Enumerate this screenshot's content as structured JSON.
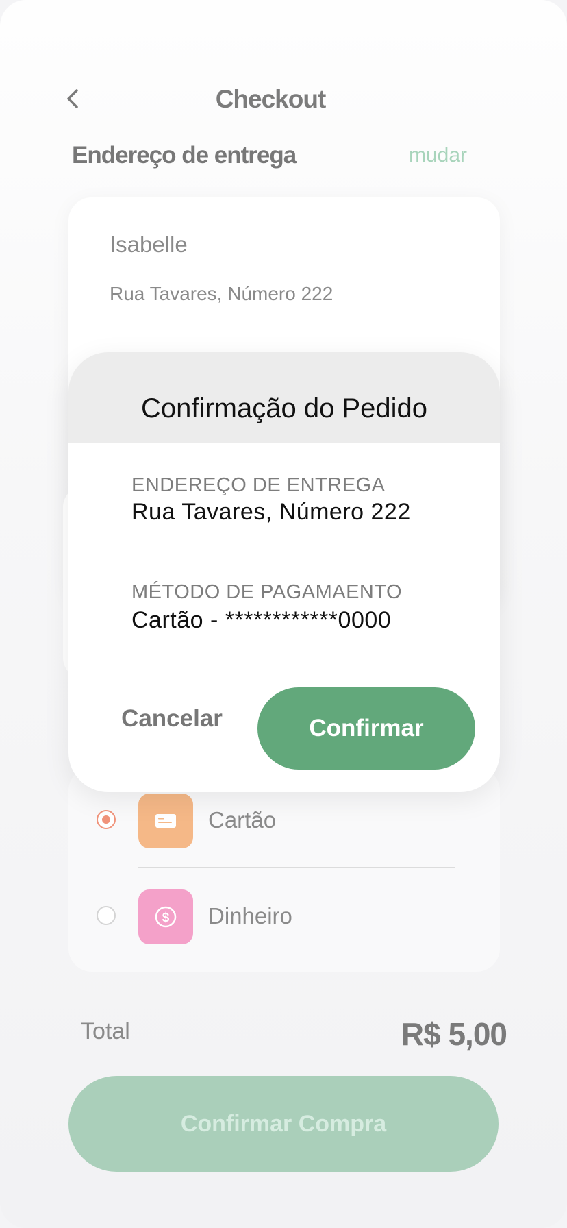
{
  "header": {
    "title": "Checkout",
    "back_icon": "chevron-left-icon"
  },
  "delivery": {
    "section_title": "Endereço de entrega",
    "change_label": "mudar",
    "name_value": "Isabelle",
    "street_value": "Rua Tavares, Número 222"
  },
  "payment": {
    "options": [
      {
        "label": "Cartão",
        "icon": "card-icon",
        "selected": true,
        "icon_color": "#f5b887"
      },
      {
        "label": "Dinheiro",
        "icon": "dollar-icon",
        "selected": false,
        "icon_color": "#f4a1c9"
      }
    ]
  },
  "summary": {
    "total_label": "Total",
    "total_value": "R$ 5,00"
  },
  "purchase_button": {
    "label": "Confirmar Compra"
  },
  "modal": {
    "title": "Confirmação do Pedido",
    "address_label": "ENDEREÇO DE ENTREGA",
    "address_value": "Rua Tavares, Número 222",
    "payment_label": "MÉTODO DE PAGAMAENTO",
    "payment_value": "Cartão - ************0000",
    "cancel_label": "Cancelar",
    "confirm_label": "Confirmar"
  },
  "colors": {
    "accent_green": "#62a87b",
    "disabled_green": "#aacfba",
    "link_green": "#a8d4bb",
    "radio_orange": "#f0937a"
  }
}
